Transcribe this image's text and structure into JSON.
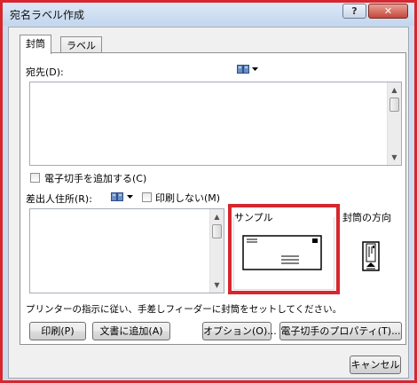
{
  "window": {
    "title": "宛名ラベル作成",
    "help_label": "?",
    "close_label": "✕"
  },
  "tabs": [
    {
      "label": "封筒"
    },
    {
      "label": "ラベル"
    }
  ],
  "recipient": {
    "label": "宛先(D):"
  },
  "epostage": {
    "label": "電子切手を追加する(C)"
  },
  "sender": {
    "label": "差出人住所(R):",
    "omit_label": "印刷しない(M)"
  },
  "preview": {
    "label": "サンプル"
  },
  "feed": {
    "label": "封筒の方向"
  },
  "instructions": "プリンターの指示に従い、手差しフィーダーに封筒をセットしてください。",
  "buttons": {
    "print": "印刷(P)",
    "add_to_doc": "文書に追加(A)",
    "options": "オプション(O)...",
    "epostage_props": "電子切手のプロパティ(T)..."
  },
  "footer": {
    "cancel": "キャンセル"
  },
  "colors": {
    "highlight_border": "#d7262e",
    "window_frame": "#cddcee"
  },
  "icons": {
    "address_book": "address-book-icon",
    "dropdown": "chevron-down-icon"
  }
}
